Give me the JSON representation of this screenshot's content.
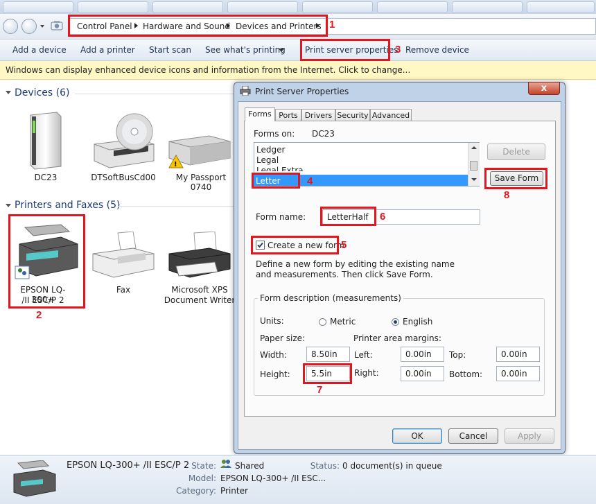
{
  "breadcrumb": [
    "Control Panel",
    "Hardware and Sound",
    "Devices and Printers"
  ],
  "toolbar": {
    "add_device": "Add a device",
    "add_printer": "Add a printer",
    "start_scan": "Start scan",
    "see_printing": "See what's printing",
    "print_server": "Print server properties",
    "remove_device": "Remove device"
  },
  "infobar": "Windows can display enhanced device icons and information from the Internet. Click to change...",
  "devices": {
    "title": "Devices (6)",
    "items": [
      "DC23",
      "DTSoftBusCd00",
      "My Passport 0740"
    ]
  },
  "printers": {
    "title": "Printers and Faxes (5)",
    "items": [
      "EPSON LQ-300+ /II ESC/P 2",
      "Fax",
      "Microsoft XPS Document Writer"
    ],
    "epson_line1": "EPSON LQ-300+",
    "epson_line2": "/II ESC/P 2",
    "xps_line1": "Microsoft XPS",
    "xps_line2": "Document Writer"
  },
  "dialog": {
    "title": "Print Server Properties",
    "close_label": "x",
    "tabs": [
      "Forms",
      "Ports",
      "Drivers",
      "Security",
      "Advanced"
    ],
    "forms_on_label": "Forms on:",
    "forms_on_value": "DC23",
    "forms_list": [
      "Ledger",
      "Legal",
      "Legal Extra",
      "Letter"
    ],
    "selected_form": "Letter",
    "delete_button": "Delete",
    "save_form_button": "Save Form",
    "form_name_label": "Form name:",
    "form_name_value": "LetterHalf",
    "create_new_form_label": "Create a new form",
    "create_new_form_checked": true,
    "instructions": "Define a new form by editing the existing name and measurements. Then click Save Form.",
    "form_desc_title": "Form description (measurements)",
    "units_label": "Units:",
    "unit_metric": "Metric",
    "unit_english": "English",
    "selected_unit": "English",
    "paper_size_label": "Paper size:",
    "margins_label": "Printer area margins:",
    "width_label": "Width:",
    "width_value": "8.50in",
    "height_label": "Height:",
    "height_value": "5.5in",
    "left_label": "Left:",
    "left_value": "0.00in",
    "right_label": "Right:",
    "right_value": "0.00in",
    "top_label": "Top:",
    "top_value": "0.00in",
    "bottom_label": "Bottom:",
    "bottom_value": "0.00in",
    "ok_button": "OK",
    "cancel_button": "Cancel",
    "apply_button": "Apply"
  },
  "details": {
    "name": "EPSON LQ-300+ /II ESC/P 2",
    "state_label": "State:",
    "state_value": "Shared",
    "status_label": "Status:",
    "status_value": "0 document(s) in queue",
    "model_label": "Model:",
    "model_value": "EPSON LQ-300+ /II ESC...",
    "category_label": "Category:",
    "category_value": "Printer"
  },
  "annotations": [
    "1",
    "2",
    "3",
    "4",
    "5",
    "6",
    "7",
    "8"
  ],
  "colors": {
    "annotation_red": "#e2161e",
    "selection_blue": "#3399ff",
    "section_title": "#1e3a78",
    "infobar_bg": "#fff8c4"
  }
}
